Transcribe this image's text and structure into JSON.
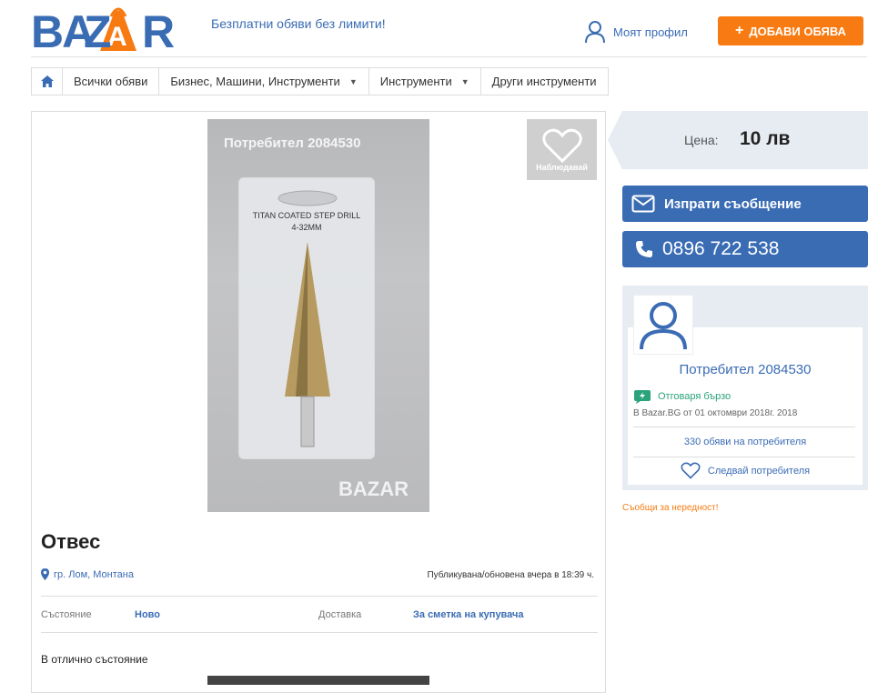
{
  "header": {
    "logo_text": "BAZAR",
    "tagline": "Безплатни обяви без лимити!",
    "profile_label": "Моят профил",
    "add_button_label": "ДОБАВИ ОБЯВА",
    "add_button_plus": "+"
  },
  "breadcrumbs": [
    {
      "label": "Всички обяви",
      "has_dropdown": false
    },
    {
      "label": "Бизнес, Машини, Инструменти",
      "has_dropdown": true
    },
    {
      "label": "Инструменти",
      "has_dropdown": true
    },
    {
      "label": "Други инструменти",
      "has_dropdown": false
    }
  ],
  "listing": {
    "photo_watermark": "Потребител 2084530",
    "photo_package_text": "TITAN COATED STEP DRILL\n4-32MM",
    "photo_brand_watermark": "BAZAR",
    "watch_label": "Наблюдавай",
    "title": "Отвес",
    "location": "гр. Лом, Монтана",
    "published": "Публикувана/обновена вчера в 18:39 ч.",
    "condition_label": "Състояние",
    "condition_value": "Ново",
    "delivery_label": "Доставка",
    "delivery_value": "За сметка на купувача",
    "description": "В отлично състояние"
  },
  "sidebar": {
    "price_label": "Цена:",
    "price_value": "10 лв",
    "message_button": "Изпрати съобщение",
    "phone": "0896 722 538",
    "user_name": "Потребител 2084530",
    "fast_reply": "Отговаря бързо",
    "member_since": "В Bazar.BG от 01 октомври 2018г. 2018",
    "ads_count": "330 обяви на потребителя",
    "follow_label": "Следвай потребителя",
    "report_label": "Съобщи за нередност!"
  },
  "colors": {
    "brand_blue": "#3a6cb4",
    "accent_orange": "#f77b12",
    "green": "#2aa37a"
  }
}
